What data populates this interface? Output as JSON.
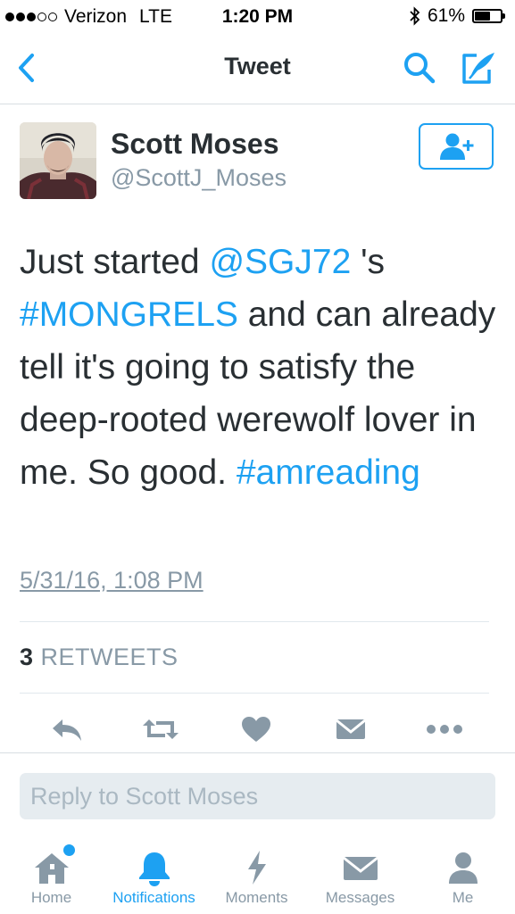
{
  "status_bar": {
    "carrier": "Verizon",
    "network": "LTE",
    "time": "1:20 PM",
    "battery": "61%",
    "battery_level": 0.61,
    "signal_bars": 3
  },
  "nav": {
    "title": "Tweet",
    "icons": [
      "chevron-left-icon",
      "search-icon",
      "compose-icon"
    ]
  },
  "tweet": {
    "author_name": "Scott Moses",
    "author_handle": "@ScottJ_Moses",
    "text_segments": [
      {
        "text": "Just started ",
        "link": false
      },
      {
        "text": "@SGJ72",
        "link": true
      },
      {
        "text": " 's ",
        "link": false
      },
      {
        "text": "#MONGRELS",
        "link": true
      },
      {
        "text": " and can already tell it's going to satisfy the deep-rooted werewolf lover in me. So good. ",
        "link": false
      },
      {
        "text": "#amreading",
        "link": true
      }
    ],
    "timestamp": "5/31/16, 1:08 PM",
    "retweet_count": "3",
    "retweet_label": "RETWEETS"
  },
  "actions": [
    "reply-icon",
    "retweet-icon",
    "like-icon",
    "direct-message-icon",
    "more-icon"
  ],
  "reply": {
    "placeholder": "Reply to Scott Moses"
  },
  "tabs": [
    {
      "label": "Home",
      "icon": "home-icon",
      "badge": true
    },
    {
      "label": "Notifications",
      "icon": "bell-icon",
      "active": true
    },
    {
      "label": "Moments",
      "icon": "lightning-icon"
    },
    {
      "label": "Messages",
      "icon": "envelope-icon"
    },
    {
      "label": "Me",
      "icon": "person-icon"
    }
  ],
  "colors": {
    "accent": "#1da1f2",
    "text": "#292f33",
    "secondary": "#8899a6"
  }
}
